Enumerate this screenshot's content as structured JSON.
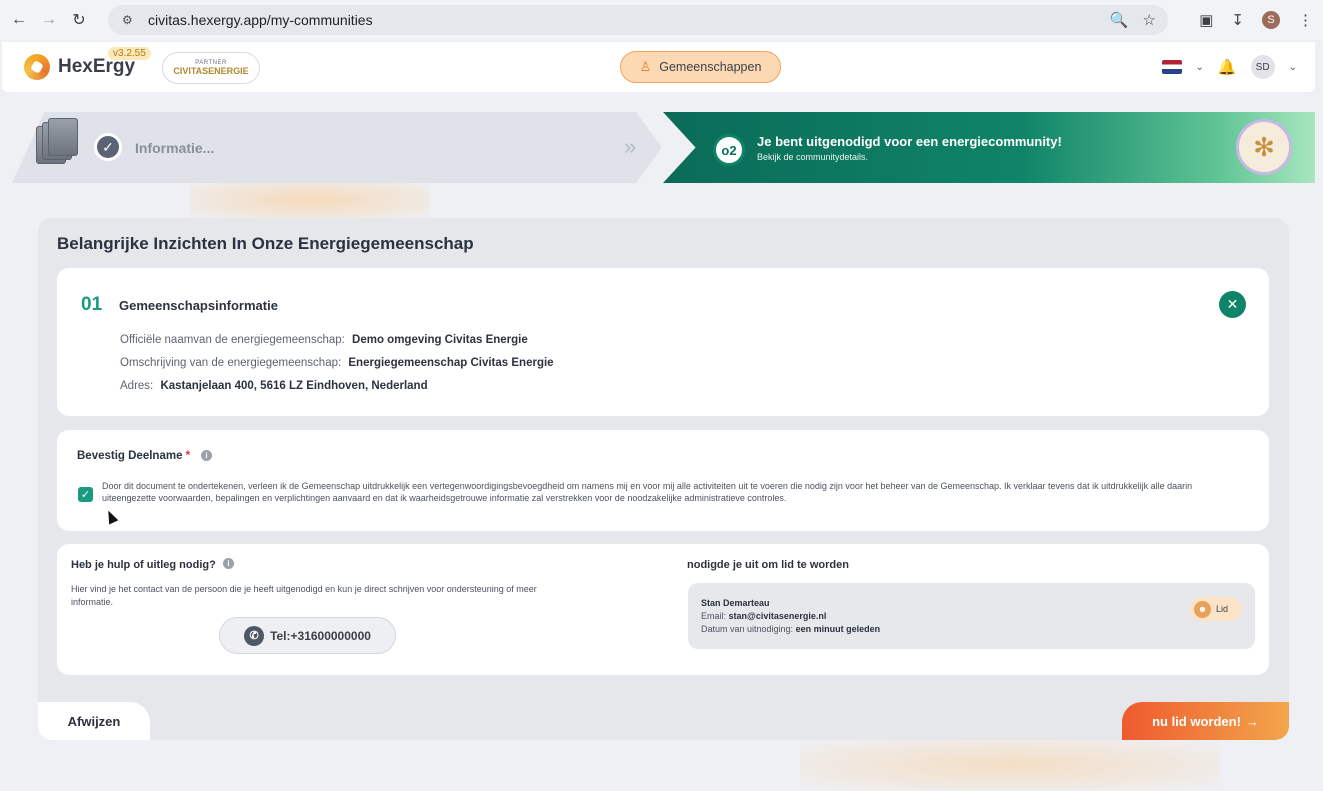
{
  "browser": {
    "url": "civitas.hexergy.app/my-communities",
    "profile_initial": "S"
  },
  "header": {
    "brand": "HexErgy",
    "version": "v3.2.55",
    "partner_label": "PARTNER",
    "partner_name": "CIVITASENERGIE",
    "nav_label": "Gemeenschappen",
    "avatar_initials": "SD"
  },
  "stepper": {
    "step1_label": "Informatie...",
    "step2_number": "o2",
    "step2_title": "Je bent uitgenodigd voor een energiecommunity!",
    "step2_subtitle": "Bekijk de communitydetails."
  },
  "main": {
    "title": "Belangrijke Inzichten In Onze Energiegemeenschap"
  },
  "info_card": {
    "number": "01",
    "title": "Gemeenschapsinformatie",
    "rows": [
      {
        "label": "Officiële naamvan de energiegemeenschap:",
        "value": "Demo omgeving Civitas Energie"
      },
      {
        "label": "Omschrijving van de energiegemeenschap:",
        "value": "Energiegemeenschap Civitas Energie"
      },
      {
        "label": "Adres:",
        "value": "Kastanjelaan 400, 5616 LZ Eindhoven, Nederland"
      }
    ]
  },
  "confirm": {
    "title": "Bevestig Deelname",
    "required_mark": "*",
    "text": "Door dit document te ondertekenen, verleen ik de Gemeenschap uitdrukkelijk een vertegenwoordigingsbevoegdheid om namens mij en voor mij alle activiteiten uit te voeren die nodig zijn voor het beheer van de Gemeenschap. Ik verklaar tevens dat ik uitdrukkelijk alle daarin uiteengezette voorwaarden, bepalingen en verplichtingen aanvaard en dat ik waarheidsgetrouwe informatie zal verstrekken voor de noodzakelijke administratieve controles.",
    "checked": true
  },
  "help": {
    "title": "Heb je hulp of uitleg nodig?",
    "description": "Hier vind je het contact van de persoon die je heeft uitgenodigd en kun je direct schrijven voor ondersteuning of meer informatie.",
    "tel_label": "Tel:+31600000000"
  },
  "inviter": {
    "title": "nodigde je uit om lid te worden",
    "name": "Stan Demarteau",
    "email_label": "Email:",
    "email": "stan@civitasenergie.nl",
    "date_label": "Datum van uitnodiging:",
    "date": "een minuut geleden",
    "badge": "Lid"
  },
  "footer": {
    "reject_label": "Afwijzen",
    "join_label": "nu lid worden!"
  },
  "colors": {
    "accent_green": "#0f8468",
    "accent_orange": "#ee5a2f",
    "nav_pill": "#fcd9b2"
  }
}
